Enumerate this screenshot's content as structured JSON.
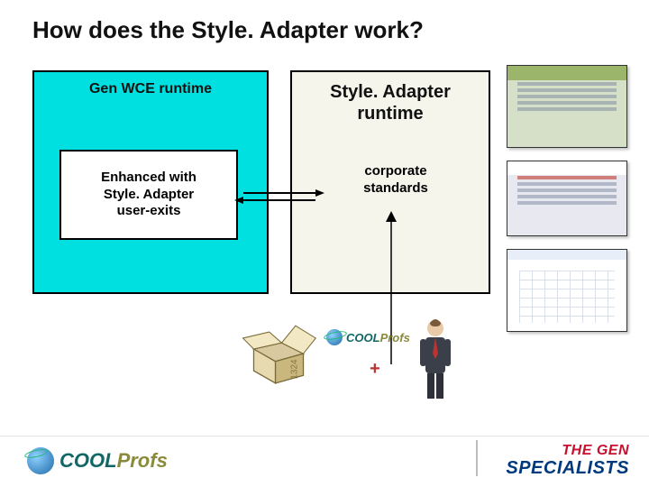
{
  "title": "How does the Style. Adapter work?",
  "left_box": {
    "label": "Gen WCE runtime",
    "inner": "Enhanced with\nStyle. Adapter\nuser-exits"
  },
  "right_box": {
    "label": "Style. Adapter\nruntime",
    "inner": "corporate\nstandards"
  },
  "plus": "+",
  "num": "1324",
  "mini_logo": {
    "cool": "COOL",
    "profs": "Profs"
  },
  "footer_left": {
    "cool": "COOL",
    "profs": "Profs"
  },
  "footer_right": {
    "line1": "THE GEN",
    "line2": "SPECIALISTS"
  }
}
